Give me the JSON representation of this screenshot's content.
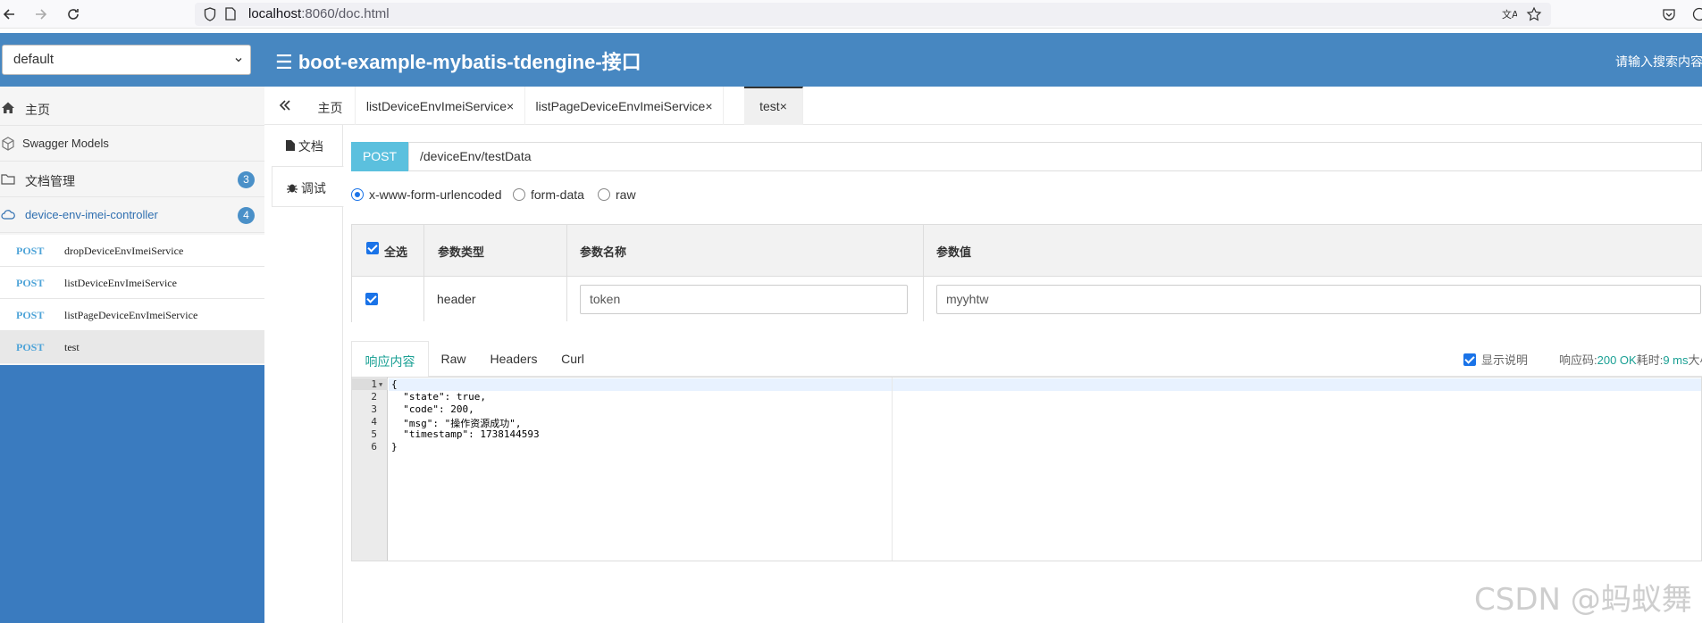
{
  "browser": {
    "url_host": "localhost",
    "url_path": ":8060/doc.html"
  },
  "header": {
    "group_selected": "default",
    "title": "☰ boot-example-mybatis-tdengine-接口",
    "search_placeholder": "请输入搜索内容"
  },
  "sidebar": {
    "items": [
      {
        "label": "主页",
        "icon": "home-icon"
      },
      {
        "label": "Swagger Models",
        "icon": "cube-icon"
      },
      {
        "label": "文档管理",
        "icon": "folder-icon",
        "badge": "3"
      },
      {
        "label": "device-env-imei-controller",
        "icon": "cloud-icon",
        "badge": "4"
      }
    ],
    "apis": [
      {
        "method": "POST",
        "name": "dropDeviceEnvImeiService"
      },
      {
        "method": "POST",
        "name": "listDeviceEnvImeiService"
      },
      {
        "method": "POST",
        "name": "listPageDeviceEnvImeiService"
      },
      {
        "method": "POST",
        "name": "test"
      }
    ]
  },
  "tabs": [
    {
      "label": "主页"
    },
    {
      "label": "listDeviceEnvImeiService×"
    },
    {
      "label": "listPageDeviceEnvImeiService×"
    },
    {
      "label": "test×"
    }
  ],
  "mini_tabs": {
    "doc": "文档",
    "debug": "调试"
  },
  "request": {
    "method": "POST",
    "path": "/deviceEnv/testData",
    "content_types": [
      "x-www-form-urlencoded",
      "form-data",
      "raw"
    ],
    "selected_content_type": "x-www-form-urlencoded"
  },
  "params": {
    "headers": {
      "select_all": "全选",
      "type": "参数类型",
      "name": "参数名称",
      "value": "参数值"
    },
    "rows": [
      {
        "checked": true,
        "type": "header",
        "name": "token",
        "value": "myyhtw"
      }
    ]
  },
  "response": {
    "tabs": [
      "响应内容",
      "Raw",
      "Headers",
      "Curl"
    ],
    "show_desc": "显示说明",
    "status_label": "响应码:",
    "status_value": "200 OK",
    "time_label": "耗时:",
    "time_value": "9 ms",
    "size_label": "大小",
    "lines": [
      {
        "n": "1",
        "text": "{"
      },
      {
        "n": "2",
        "text": "  \"state\": true,"
      },
      {
        "n": "3",
        "text": "  \"code\": 200,"
      },
      {
        "n": "4",
        "text": "  \"msg\": \"操作资源成功\","
      },
      {
        "n": "5",
        "text": "  \"timestamp\": 1738144593"
      },
      {
        "n": "6",
        "text": "}"
      }
    ]
  },
  "watermark": "CSDN @蚂蚁舞",
  "colors": {
    "header_bg": "#4787c1",
    "sidebar_bg": "#3a7bbf",
    "accent": "#1aa094",
    "post_badge": "#5bc0de"
  }
}
